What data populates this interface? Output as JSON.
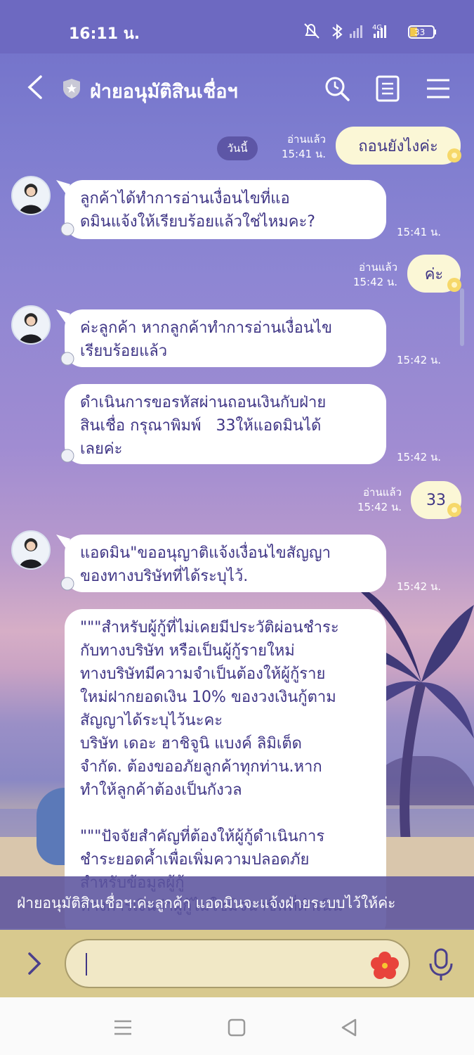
{
  "status_bar": {
    "time": "16:11 น.",
    "battery": "33",
    "network": "4G"
  },
  "header": {
    "title": "ฝ่ายอนุมัติสินเชื่อฯ",
    "icons": [
      "back-icon",
      "shield-icon",
      "search-icon",
      "notes-icon",
      "menu-icon"
    ]
  },
  "chat": {
    "date_pill": "วันนี้",
    "messages": [
      {
        "side": "me",
        "text": "ถอนยังไงค่ะ",
        "read": "อ่านแล้ว",
        "time": "15:41 น."
      },
      {
        "side": "them",
        "text": "ลูกค้าได้ทำการอ่านเงื่อนไขที่แอ\nดมินแจ้งให้เรียบร้อยแล้วใช่ไหมคะ?",
        "time": "15:41 น."
      },
      {
        "side": "me",
        "text": "ค่ะ",
        "read": "อ่านแล้ว",
        "time": "15:42 น."
      },
      {
        "side": "them",
        "text": "ค่ะลูกค้า หากลูกค้าทำการอ่านเงื่อนไข\nเรียบร้อยแล้ว",
        "time": "15:42 น."
      },
      {
        "side": "them",
        "text": "ดำเนินการขอรหัสผ่านถอนเงินกับฝ่าย\nสินเชื่อ กรุณาพิมพ์   33ให้แอดมินได้\nเลยค่ะ",
        "time": "15:42 น."
      },
      {
        "side": "me",
        "text": "33",
        "read": "อ่านแล้ว",
        "time": "15:42 น."
      },
      {
        "side": "them",
        "text": "แอดมิน\"ขออนุญาติแจ้งเงื่อนไขสัญญา\nของทางบริษัทที่ได้ระบุไว้.",
        "time": "15:42 น."
      },
      {
        "side": "them",
        "text": "\"\"\"สำหรับผู้กู้ที่ไม่เคยมีประวัติผ่อนชำระ\nกับทางบริษัท หรือเป็นผู้กู้รายใหม่\nทางบริษัทมีความจำเป็นต้องให้ผู้กู้ราย\nใหม่ฝากยอดเงิน 10% ของวงเงินกู้ตาม\nสัญญาได้ระบุไว้นะคะ\nบริษัท เดอะ ฮาชิจูนิ แบงค์ ลิมิเต็ด\nจำกัด. ต้องขออภัยลูกค้าทุกท่าน.หาก\nทำให้ลูกค้าต้องเป็นกังวล\n\n\"\"\"ปัจจัยสำคัญที่ต้องให้ผู้กู้ดำเนินการ\nชำระยอดค้ำเพื่อเพิ่มความปลอดภัย\nสำหรับข้อมูลผู้กู้\nทางการเงินว่าผู้กู้ไม่ใช่มิจฉาชีพที่ดำเนิน"
      }
    ]
  },
  "notification": "ฝ่ายอนุมัติสินเชื่อฯ:ค่ะลูกค้า แอดมินจะแจ้งฝ่ายระบบไว้ให้ค่ะ",
  "input": {
    "value": "",
    "placeholder": ""
  },
  "colors": {
    "header_bg": "#6d69c1",
    "bubble_text": "#3f3585",
    "my_bubble": "#fbf7d6",
    "input_bar": "#d8c98e"
  }
}
